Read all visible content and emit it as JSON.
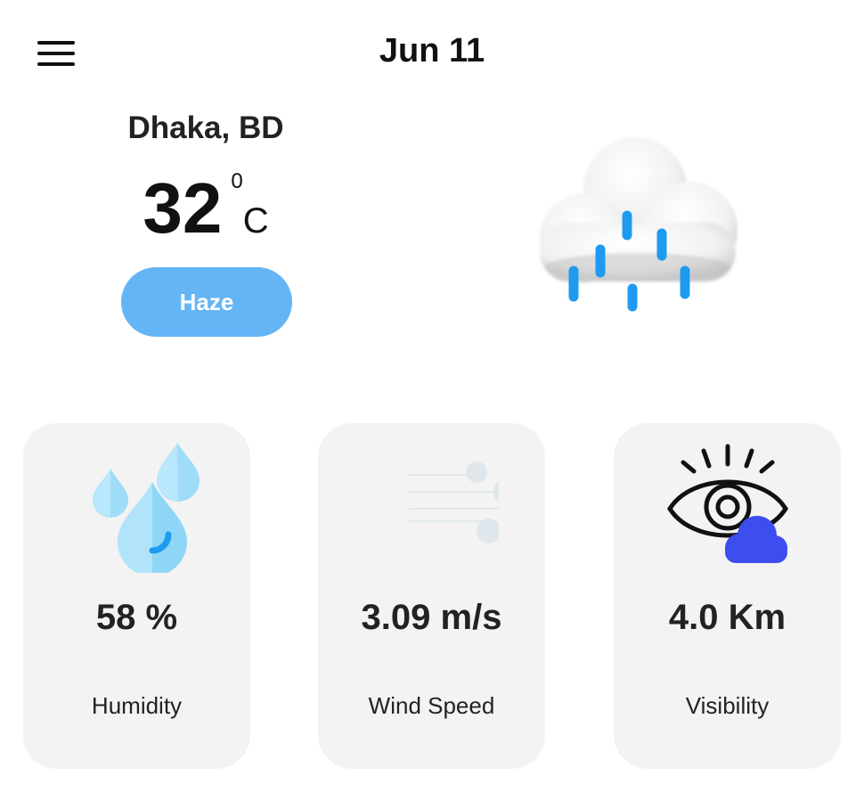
{
  "header": {
    "date": "Jun 11",
    "menu_icon": "hamburger-menu-icon"
  },
  "location": {
    "city": "Dhaka, BD"
  },
  "current": {
    "temperature": "32",
    "unit_sup": "0",
    "unit": "C",
    "condition": "Haze",
    "condition_icon": "rain-cloud-icon"
  },
  "stats": [
    {
      "value": "58 %",
      "label": "Humidity",
      "icon": "water-drops-icon"
    },
    {
      "value": "3.09 m/s",
      "label": "Wind Speed",
      "icon": "wind-icon"
    },
    {
      "value": "4.0 Km",
      "label": "Visibility",
      "icon": "eye-cloud-icon"
    }
  ],
  "colors": {
    "accent": "#64b5f6",
    "card_bg": "#f3f3f3",
    "rain": "#1e9bf0",
    "visibility_cloud": "#3d4df0"
  }
}
